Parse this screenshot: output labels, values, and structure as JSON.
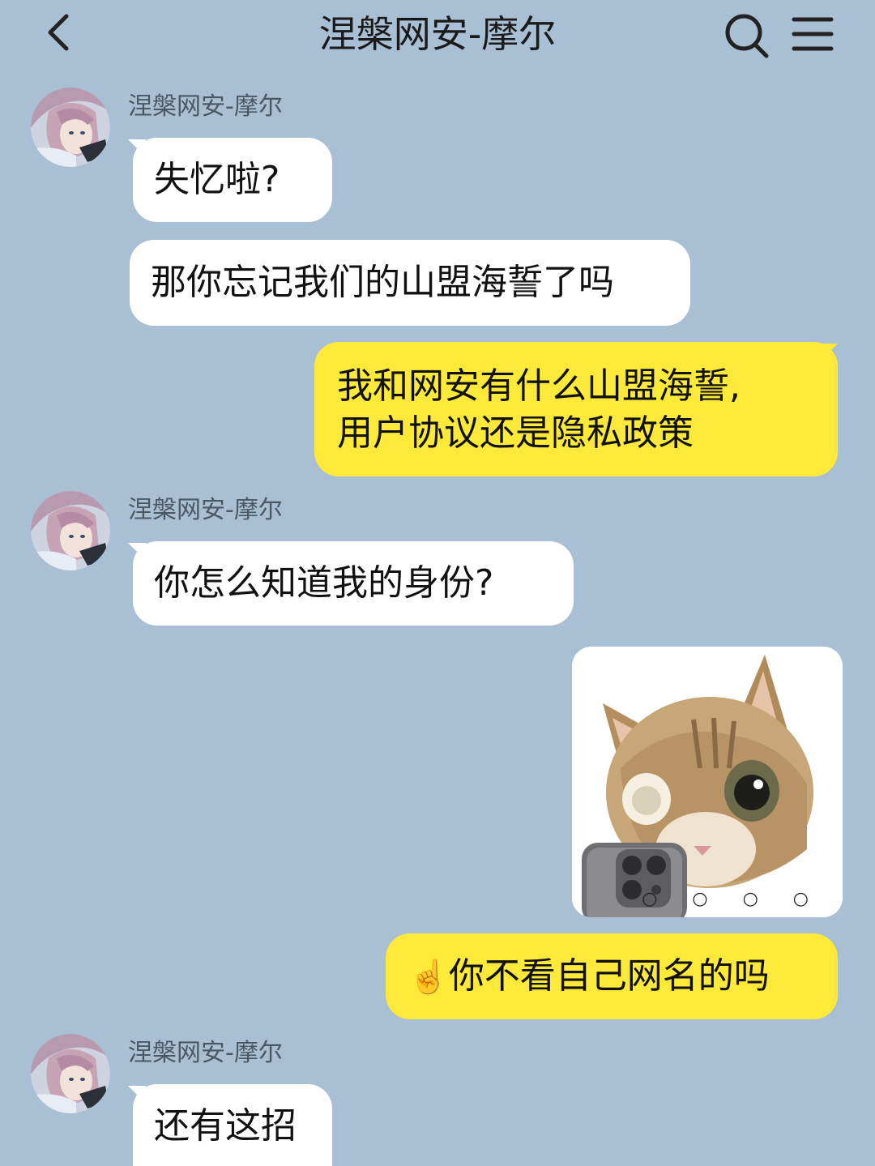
{
  "header": {
    "title": "涅槃网安-摩尔",
    "back_icon": "chevron-left-icon",
    "search_icon": "search-icon",
    "menu_icon": "menu-icon"
  },
  "messages": [
    {
      "side": "in",
      "sender": "涅槃网安-摩尔",
      "text": "失忆啦?"
    },
    {
      "side": "in",
      "text": "那你忘记我们的山盟海誓了吗"
    },
    {
      "side": "out",
      "lines": [
        "我和网安有什么山盟海誓,",
        "用户协议还是隐私政策"
      ]
    },
    {
      "side": "in",
      "sender": "涅槃网安-摩尔",
      "text": "你怎么知道我的身份?"
    },
    {
      "side": "out",
      "type": "sticker",
      "icon": "cat-with-phone-sticker",
      "dots": "○ ○ ○ ○"
    },
    {
      "side": "out",
      "emoji": "☝️",
      "text": "你不看自己网名的吗"
    },
    {
      "side": "in",
      "sender": "涅槃网安-摩尔",
      "text": "还有这招"
    }
  ],
  "colors": {
    "background": "#a9bfd3",
    "incoming_bubble": "#ffffff",
    "outgoing_bubble": "#fde93a"
  }
}
